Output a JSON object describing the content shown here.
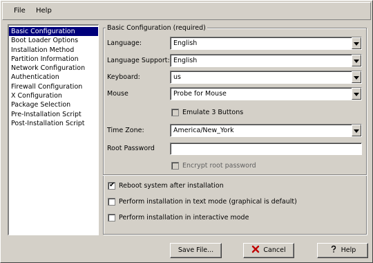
{
  "menubar": {
    "items": [
      {
        "label": "File"
      },
      {
        "label": "Help"
      }
    ]
  },
  "sidebar": {
    "items": [
      {
        "label": "Basic Configuration",
        "selected": true
      },
      {
        "label": "Boot Loader Options"
      },
      {
        "label": "Installation Method"
      },
      {
        "label": "Partition Information"
      },
      {
        "label": "Network Configuration"
      },
      {
        "label": "Authentication"
      },
      {
        "label": "Firewall Configuration"
      },
      {
        "label": "X Configuration"
      },
      {
        "label": "Package Selection"
      },
      {
        "label": "Pre-Installation Script"
      },
      {
        "label": "Post-Installation Script"
      }
    ]
  },
  "main": {
    "group_title": "Basic Configuration (required)",
    "language": {
      "label": "Language:",
      "value": "English"
    },
    "language_support": {
      "label": "Language Support:",
      "value": "English"
    },
    "keyboard": {
      "label": "Keyboard:",
      "value": "us"
    },
    "mouse": {
      "label": "Mouse",
      "value": "Probe for Mouse"
    },
    "emulate_buttons": {
      "label": "Emulate 3 Buttons",
      "checked": false,
      "enabled": false
    },
    "timezone": {
      "label": "Time Zone:",
      "value": "America/New_York"
    },
    "root_password": {
      "label": "Root Password",
      "value": ""
    },
    "encrypt_password": {
      "label": "Encrypt root password",
      "checked": false,
      "enabled": false
    },
    "reboot": {
      "label": "Reboot system after installation",
      "checked": true
    },
    "text_mode": {
      "label": "Perform installation in text mode (graphical is default)",
      "checked": false
    },
    "interactive": {
      "label": "Perform installation in interactive mode",
      "checked": false
    }
  },
  "buttons": {
    "save": "Save File...",
    "cancel": "Cancel",
    "help": "Help"
  },
  "colors": {
    "selection": "#00007b",
    "window_bg": "#d4d0c8",
    "cancel_icon": "#c00000"
  }
}
